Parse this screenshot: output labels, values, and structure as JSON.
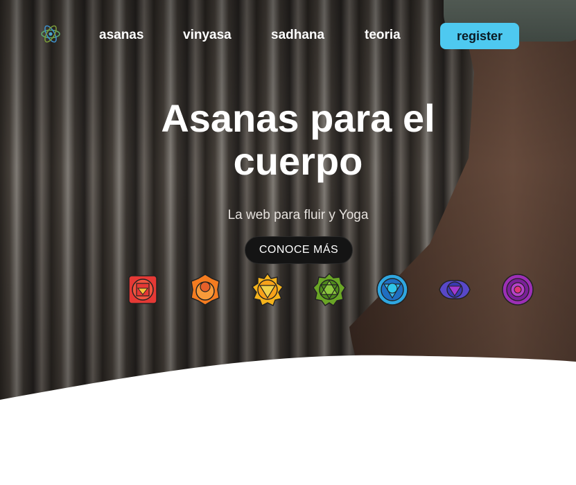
{
  "nav": {
    "logo_icon": "atom-lotus-icon",
    "links": [
      "asanas",
      "vinyasa",
      "sadhana",
      "teoria"
    ],
    "register_label": "register"
  },
  "hero": {
    "title": "Asanas para el cuerpo",
    "subtitle": "La web para fluir y Yoga",
    "cta_label": "CONOCE MÁS"
  },
  "chakras": [
    {
      "name": "root-chakra-icon",
      "color": "#e53935"
    },
    {
      "name": "sacral-chakra-icon",
      "color": "#f57c20"
    },
    {
      "name": "solar-plexus-chakra-icon",
      "color": "#f5b31c"
    },
    {
      "name": "heart-chakra-icon",
      "color": "#6aa526"
    },
    {
      "name": "throat-chakra-icon",
      "color": "#2fa6e0"
    },
    {
      "name": "third-eye-chakra-icon",
      "color": "#5848c8"
    },
    {
      "name": "crown-chakra-icon",
      "color": "#9c2fb5"
    }
  ],
  "colors": {
    "register_bg": "#4ec9f0",
    "cta_bg": "#141414",
    "text_light": "#ffffff"
  }
}
